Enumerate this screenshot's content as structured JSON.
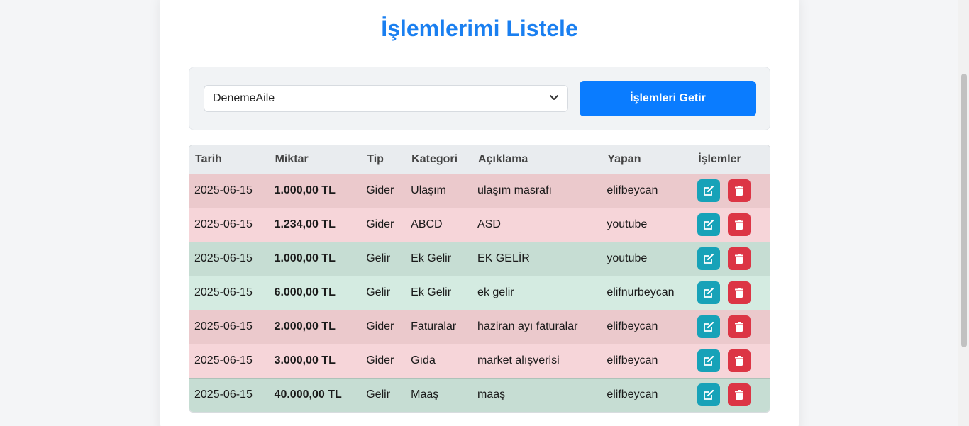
{
  "page": {
    "title": "İşlemlerimi Listele"
  },
  "filter": {
    "selected_family": "DenemeAile",
    "fetch_button": "İşlemleri Getir"
  },
  "table": {
    "headers": [
      "Tarih",
      "Miktar",
      "Tip",
      "Kategori",
      "Açıklama",
      "Yapan",
      "İşlemler"
    ],
    "rows": [
      {
        "date": "2025-06-15",
        "amount": "1.000,00 TL",
        "type": "Gider",
        "category": "Ulaşım",
        "description": "ulaşım masrafı",
        "user": "elifbeycan"
      },
      {
        "date": "2025-06-15",
        "amount": "1.234,00 TL",
        "type": "Gider",
        "category": "ABCD",
        "description": "ASD",
        "user": "youtube"
      },
      {
        "date": "2025-06-15",
        "amount": "1.000,00 TL",
        "type": "Gelir",
        "category": "Ek Gelir",
        "description": "EK GELİR",
        "user": "youtube"
      },
      {
        "date": "2025-06-15",
        "amount": "6.000,00 TL",
        "type": "Gelir",
        "category": "Ek Gelir",
        "description": "ek gelir",
        "user": "elifnurbeycan"
      },
      {
        "date": "2025-06-15",
        "amount": "2.000,00 TL",
        "type": "Gider",
        "category": "Faturalar",
        "description": "haziran ayı faturalar",
        "user": "elifbeycan"
      },
      {
        "date": "2025-06-15",
        "amount": "3.000,00 TL",
        "type": "Gider",
        "category": "Gıda",
        "description": "market alışverisi",
        "user": "elifbeycan"
      },
      {
        "date": "2025-06-15",
        "amount": "40.000,00 TL",
        "type": "Gelir",
        "category": "Maaş",
        "description": "maaş",
        "user": "elifbeycan"
      }
    ]
  },
  "colors": {
    "title": "#1a7ff0",
    "primary_button": "#0a7cff",
    "edit_button": "#17a2b8",
    "delete_button": "#dc3545",
    "expense_row": "#f6d5d9",
    "income_row": "#d4ebe1"
  },
  "icons": {
    "edit": "edit-icon",
    "delete": "trash-icon",
    "select": "chevron-down-icon"
  }
}
